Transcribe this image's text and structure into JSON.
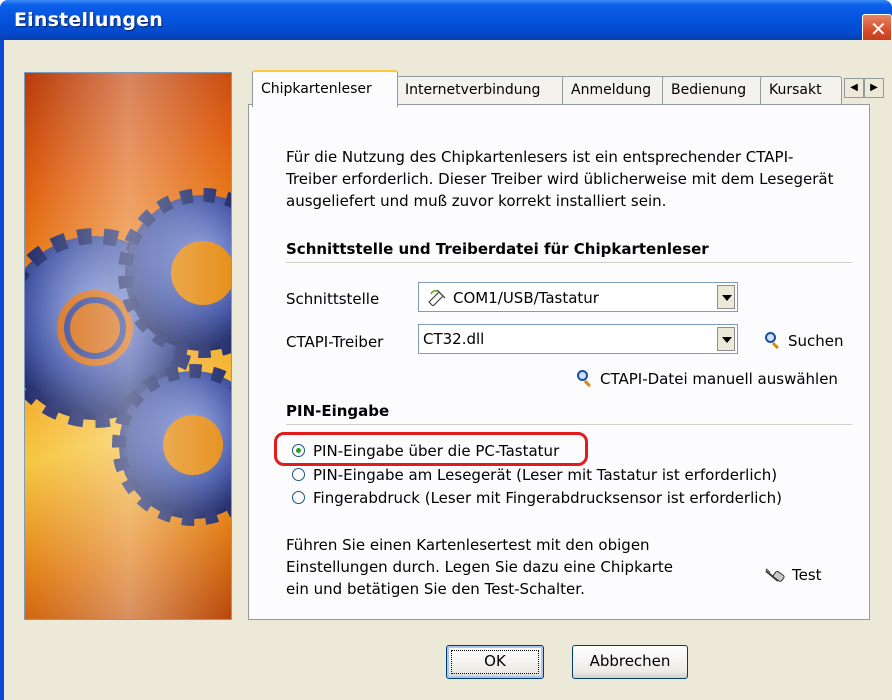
{
  "window": {
    "title": "Einstellungen"
  },
  "tabs": [
    {
      "label": "Chipkartenleser"
    },
    {
      "label": "Internetverbindung"
    },
    {
      "label": "Anmeldung"
    },
    {
      "label": "Bedienung"
    },
    {
      "label": "Kursakt"
    }
  ],
  "intro": {
    "line1": "Für die Nutzung des Chipkartenlesers ist ein entsprechender CTAPI-",
    "line2": "Treiber erforderlich. Dieser Treiber wird üblicherweise mit dem Lesegerät",
    "line3": "ausgeliefert und muß zuvor korrekt installiert sein."
  },
  "interface_section": {
    "title": "Schnittstelle und Treiberdatei für Chipkartenleser",
    "schnittstelle_label": "Schnittstelle",
    "schnittstelle_value": "COM1/USB/Tastatur",
    "ctapi_label": "CTAPI-Treiber",
    "ctapi_value": "CT32.dll",
    "search_label": "Suchen",
    "manual_label": "CTAPI-Datei manuell auswählen"
  },
  "pin_section": {
    "title": "PIN-Eingabe",
    "options": [
      {
        "label": "PIN-Eingabe über die PC-Tastatur",
        "checked": true
      },
      {
        "label": "PIN-Eingabe am Lesegerät (Leser mit Tastatur ist erforderlich)",
        "checked": false
      },
      {
        "label": "Fingerabdruck (Leser mit Fingerabdrucksensor ist erforderlich)",
        "checked": false
      }
    ]
  },
  "test_section": {
    "line1": "Führen Sie einen Kartenlesertest mit den obigen",
    "line2": "Einstellungen durch. Legen Sie dazu eine Chipkarte",
    "line3": "ein und betätigen Sie den Test-Schalter.",
    "test_label": "Test"
  },
  "buttons": {
    "ok": "OK",
    "cancel": "Abbrechen"
  },
  "colors": {
    "titlebar": "#0553dd",
    "dialog_bg": "#ece9d8",
    "highlight": "#e21b1b",
    "tab_accent": "#ffc83c"
  }
}
